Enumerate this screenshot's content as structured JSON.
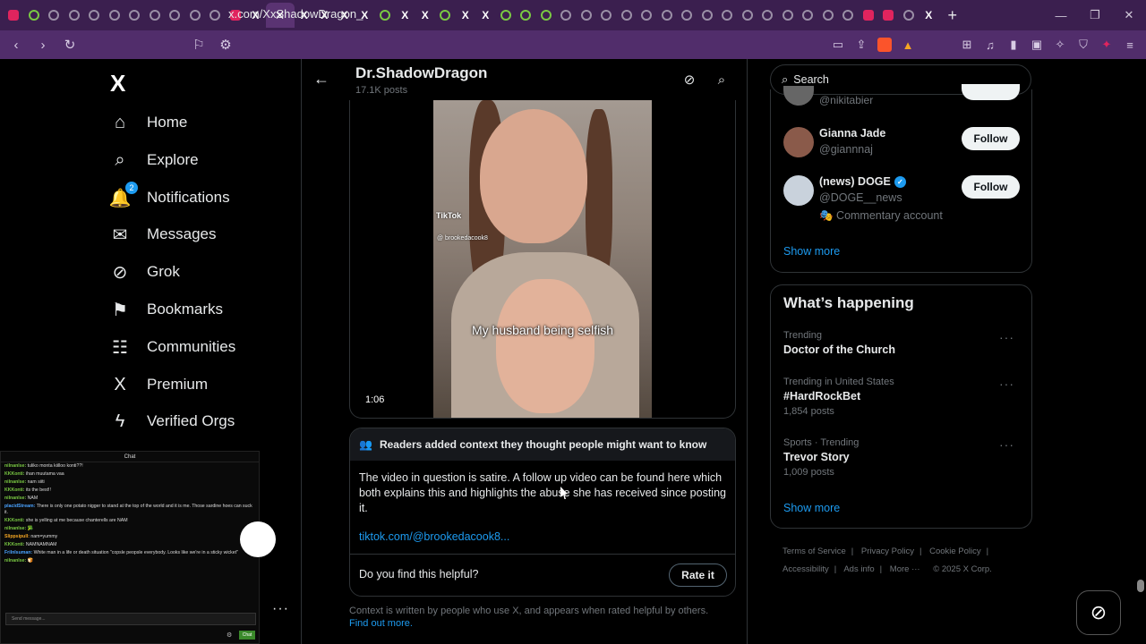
{
  "browser": {
    "url": "x.com/XxShadowDragon_",
    "new_tab": "+",
    "win_min": "—",
    "win_max": "❐",
    "win_close": "✕",
    "tab_close": "✕",
    "ext_badge": "1"
  },
  "nav": {
    "logo": "X",
    "items": [
      {
        "label": "Home",
        "icon": "home-icon",
        "glyph": "⌂"
      },
      {
        "label": "Explore",
        "icon": "search-icon",
        "glyph": "⌕"
      },
      {
        "label": "Notifications",
        "icon": "bell-icon",
        "glyph": "🔔",
        "badge": "2"
      },
      {
        "label": "Messages",
        "icon": "mail-icon",
        "glyph": "✉"
      },
      {
        "label": "Grok",
        "icon": "grok-icon",
        "glyph": "⊘"
      },
      {
        "label": "Bookmarks",
        "icon": "bookmark-icon",
        "glyph": "⚑"
      },
      {
        "label": "Communities",
        "icon": "people-icon",
        "glyph": "☷"
      },
      {
        "label": "Premium",
        "icon": "x-icon",
        "glyph": "X"
      },
      {
        "label": "Verified Orgs",
        "icon": "lightning-icon",
        "glyph": "ϟ"
      }
    ],
    "more_dots": "···"
  },
  "chat": {
    "title": "Chat",
    "lines": [
      {
        "user": "nilnanlse:",
        "text": "tuliko monta kiilloo konti??!"
      },
      {
        "user": "KKKonti:",
        "text": "ihan muutama vaa"
      },
      {
        "user": "nilnanlse:",
        "text": "nam siiti"
      },
      {
        "user": "KKKonti:",
        "text": "its the best!!"
      },
      {
        "user": "nilnanlse:",
        "text": "NAM"
      },
      {
        "user": "placidStream:",
        "text": "There is only one potato nigger to stand at the top of the world and it is me. Those sardine hoes can suck it.",
        "cls": "blue"
      },
      {
        "user": "KKKonti:",
        "text": "she is yelling at me because chanterells are NAM"
      },
      {
        "user": "nilnanlse:",
        "text": "🥦"
      },
      {
        "user": "Slippsipull:",
        "text": "nam=yummy",
        "cls": "orange"
      },
      {
        "user": "KKKonti:",
        "text": "NAMNAMNAM"
      },
      {
        "user": "Frilnlsuman:",
        "text": "White man in a life or death situation \"copsle peopsle everybody. Looks like we're in a sticky wicket\"",
        "cls": "blue"
      },
      {
        "user": "nilnanlse:",
        "text": "🍞"
      }
    ],
    "input_placeholder": "Send message...",
    "send_label": "Chat"
  },
  "header": {
    "name": "Dr.ShadowDragon",
    "posts": "17.1K posts"
  },
  "video": {
    "tiktok": "TikTok",
    "handle": "@ brookedacook8",
    "caption": "My husband being selfish",
    "duration": "1:06"
  },
  "note": {
    "title": "Readers added context they thought people might want to know",
    "body": "The video in question is satire. A follow up video can be found here which both explains this and highlights the abuse she has received since posting it.",
    "link": "tiktok.com/@brookedacook8...",
    "question": "Do you find this helpful?",
    "rate_label": "Rate it"
  },
  "footnote": {
    "text": "Context is written by people who use X, and appears when rated helpful by others.",
    "link": "Find out more."
  },
  "search": {
    "placeholder": "Search"
  },
  "who_to_follow": {
    "partial_handle": "@nikitabier",
    "users": [
      {
        "name": "Gianna Jade",
        "handle": "@giannnaj",
        "avatar_color": "#8a5a4a",
        "button": "Follow"
      },
      {
        "name": "(news) DOGE",
        "handle": "@DOGE__news",
        "extra": "🎭 Commentary account",
        "avatar_color": "#c9d2dc",
        "button": "Follow",
        "verified": "✓"
      }
    ],
    "show_more": "Show more"
  },
  "happening": {
    "title": "What’s happening",
    "trends": [
      {
        "context": "Trending",
        "title": "Doctor of the Church",
        "count": ""
      },
      {
        "context": "Trending in United States",
        "title": "#HardRockBet",
        "count": "1,854 posts"
      },
      {
        "context": "Sports · Trending",
        "title": "Trevor Story",
        "count": "1,009 posts"
      }
    ],
    "more_dots": "···",
    "show_more": "Show more"
  },
  "footer": {
    "links": [
      "Terms of Service",
      "Privacy Policy",
      "Cookie Policy",
      "Accessibility",
      "Ads info",
      "More ···"
    ],
    "copyright": "© 2025 X Corp."
  },
  "colors": {
    "accent": "#1d9bf0",
    "browser": "#3b1f4f"
  }
}
